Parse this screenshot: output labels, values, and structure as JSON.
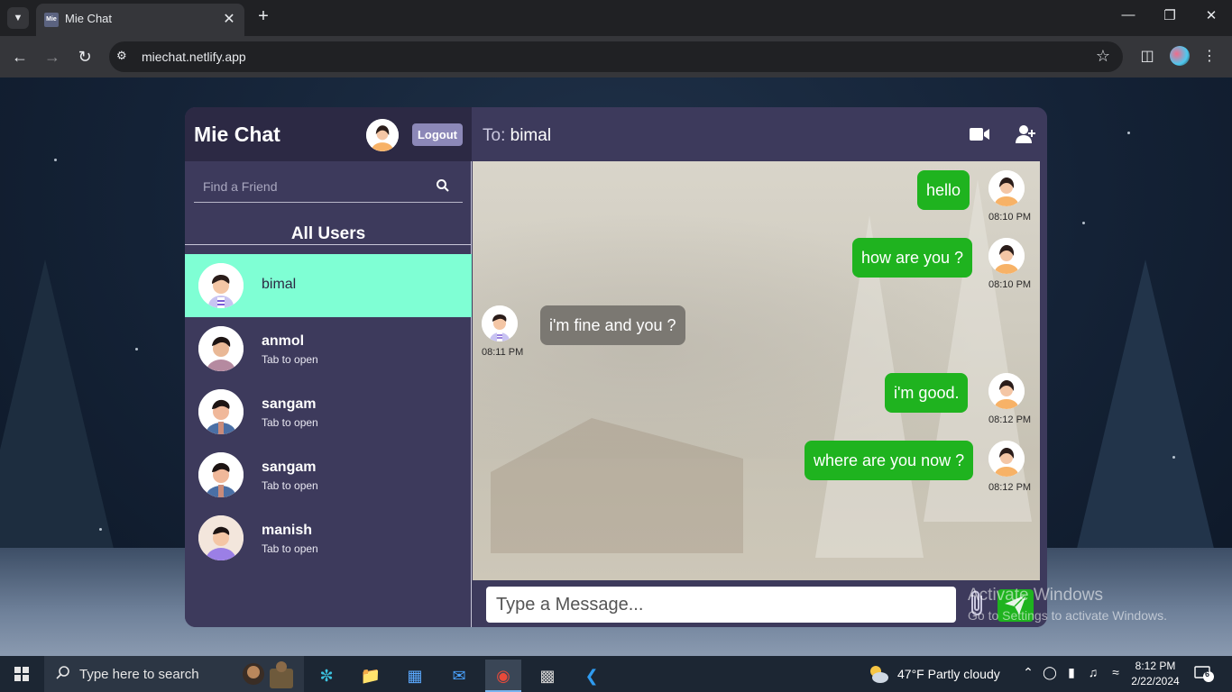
{
  "browser": {
    "tab_title": "Mie Chat",
    "favicon_text": "Mie",
    "url": "miechat.netlify.app"
  },
  "app": {
    "brand": "Mie Chat",
    "logout_label": "Logout",
    "search_placeholder": "Find a Friend",
    "users_title": "All Users",
    "users": [
      {
        "name": "bimal",
        "subtitle": "",
        "active": true
      },
      {
        "name": "anmol",
        "subtitle": "Tab to open",
        "active": false
      },
      {
        "name": "sangam",
        "subtitle": "Tab to open",
        "active": false
      },
      {
        "name": "sangam",
        "subtitle": "Tab to open",
        "active": false
      },
      {
        "name": "manish",
        "subtitle": "Tab to open",
        "active": false
      }
    ],
    "chat": {
      "to_prefix": "To:",
      "to_name": "bimal",
      "messages": [
        {
          "text": "hello",
          "time": "08:10 PM",
          "direction": "out"
        },
        {
          "text": "how are you ?",
          "time": "08:10 PM",
          "direction": "out"
        },
        {
          "text": "i'm fine and you ?",
          "time": "08:11 PM",
          "direction": "in"
        },
        {
          "text": "i'm good.",
          "time": "08:12 PM",
          "direction": "out"
        },
        {
          "text": "where are you now ?",
          "time": "08:12 PM",
          "direction": "out"
        }
      ],
      "input_placeholder": "Type a Message..."
    }
  },
  "watermark": {
    "title": "Activate Windows",
    "subtitle": "Go to Settings to activate Windows."
  },
  "taskbar": {
    "search_text": "Type here to search",
    "weather_text": "47°F  Partly cloudy",
    "time": "8:12 PM",
    "date": "2/22/2024",
    "notification_count": "6"
  },
  "colors": {
    "sidebar_bg": "#3d3a5c",
    "active_user_bg": "#7fffd4",
    "outgoing_bubble": "#1fb31f",
    "incoming_bubble": "#7b7872",
    "logout_bg": "#8c88b8"
  }
}
